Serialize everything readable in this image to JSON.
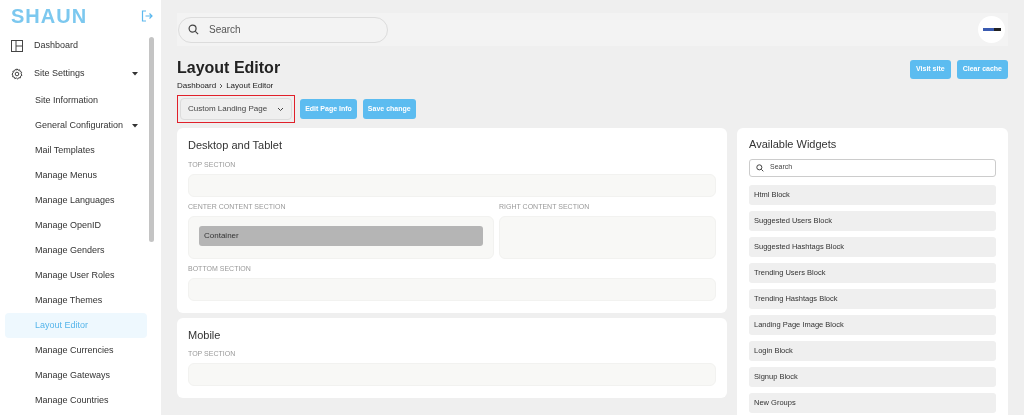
{
  "sidebar": {
    "logo": "SHAUN",
    "items": [
      {
        "label": "Dashboard",
        "kind": "dashboard",
        "expandable": false,
        "selected": false
      },
      {
        "label": "Site Settings",
        "kind": "settings",
        "expandable": true,
        "selected": false
      },
      {
        "label": "Site Information",
        "kind": "sub",
        "expandable": false,
        "selected": false
      },
      {
        "label": "General Configuration",
        "kind": "sub",
        "expandable": true,
        "selected": false
      },
      {
        "label": "Mail Templates",
        "kind": "sub",
        "expandable": false,
        "selected": false
      },
      {
        "label": "Manage Menus",
        "kind": "sub",
        "expandable": false,
        "selected": false
      },
      {
        "label": "Manage Languages",
        "kind": "sub",
        "expandable": false,
        "selected": false
      },
      {
        "label": "Manage OpenID",
        "kind": "sub",
        "expandable": false,
        "selected": false
      },
      {
        "label": "Manage Genders",
        "kind": "sub",
        "expandable": false,
        "selected": false
      },
      {
        "label": "Manage User Roles",
        "kind": "sub",
        "expandable": false,
        "selected": false
      },
      {
        "label": "Manage Themes",
        "kind": "sub",
        "expandable": false,
        "selected": false
      },
      {
        "label": "Layout Editor",
        "kind": "sub",
        "expandable": false,
        "selected": true
      },
      {
        "label": "Manage Currencies",
        "kind": "sub",
        "expandable": false,
        "selected": false
      },
      {
        "label": "Manage Gateways",
        "kind": "sub",
        "expandable": false,
        "selected": false
      },
      {
        "label": "Manage Countries",
        "kind": "sub",
        "expandable": false,
        "selected": false
      }
    ]
  },
  "header": {
    "search": {
      "placeholder": "Search"
    }
  },
  "page": {
    "title": "Layout Editor",
    "breadcrumb": [
      "Dashboard",
      "Layout Editor"
    ],
    "header_buttons": [
      "Visit site",
      "Clear cache"
    ],
    "page_select": {
      "value": "Custom Landing Page",
      "highlighted": true
    },
    "buttons": [
      "Edit Page Info",
      "Save change"
    ]
  },
  "layouts": [
    {
      "title": "Desktop and Tablet",
      "sections": [
        {
          "label": "TOP SECTION",
          "kind": "full"
        },
        {
          "label": "CENTER CONTENT SECTION",
          "kind": "center",
          "widgets": [
            "Container"
          ]
        },
        {
          "label": "RIGHT CONTENT SECTION",
          "kind": "right"
        },
        {
          "label": "BOTTOM SECTION",
          "kind": "full"
        }
      ]
    },
    {
      "title": "Mobile",
      "sections": [
        {
          "label": "TOP SECTION",
          "kind": "full"
        }
      ]
    }
  ],
  "widgets_panel": {
    "title": "Available Widgets",
    "search": {
      "placeholder": "Search"
    },
    "items": [
      "Html Block",
      "Suggested Users Block",
      "Suggested Hashtags Block",
      "Trending Users Block",
      "Trending Hashtags Block",
      "Landing Page Image Block",
      "Login Block",
      "Signup Block",
      "New Groups"
    ]
  }
}
